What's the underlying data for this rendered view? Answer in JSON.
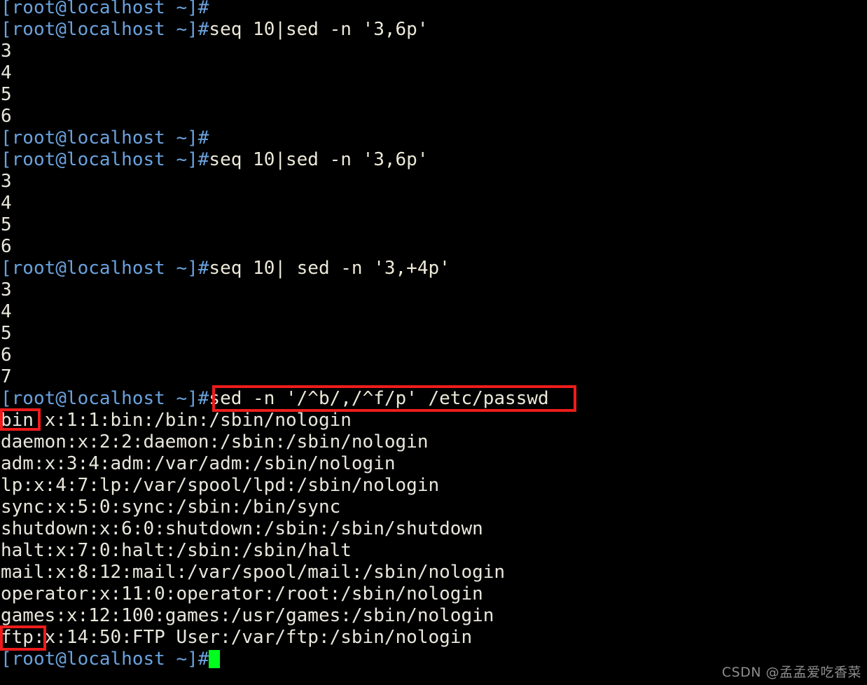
{
  "terminal": {
    "background_color": "#000000",
    "prompt_color": "#6aa2dd",
    "command_color": "#ece9d8",
    "output_color": "#e9e7dc",
    "cursor_color": "#00ff1e",
    "annotation_color": "#ee1c1c",
    "prompt": "[root@localhost ~]#",
    "lines": [
      {
        "type": "prompt",
        "prompt": "[root@localhost ~]#",
        "command": ""
      },
      {
        "type": "prompt",
        "prompt": "[root@localhost ~]#",
        "command": "seq 10|sed -n '3,6p'"
      },
      {
        "type": "output",
        "text": "3"
      },
      {
        "type": "output",
        "text": "4"
      },
      {
        "type": "output",
        "text": "5"
      },
      {
        "type": "output",
        "text": "6"
      },
      {
        "type": "prompt",
        "prompt": "[root@localhost ~]#",
        "command": ""
      },
      {
        "type": "prompt",
        "prompt": "[root@localhost ~]#",
        "command": "seq 10|sed -n '3,6p'"
      },
      {
        "type": "output",
        "text": "3"
      },
      {
        "type": "output",
        "text": "4"
      },
      {
        "type": "output",
        "text": "5"
      },
      {
        "type": "output",
        "text": "6"
      },
      {
        "type": "prompt",
        "prompt": "[root@localhost ~]#",
        "command": "seq 10| sed -n '3,+4p'"
      },
      {
        "type": "output",
        "text": "3"
      },
      {
        "type": "output",
        "text": "4"
      },
      {
        "type": "output",
        "text": "5"
      },
      {
        "type": "output",
        "text": "6"
      },
      {
        "type": "output",
        "text": "7"
      },
      {
        "type": "prompt",
        "prompt": "[root@localhost ~]#",
        "command": "sed -n '/^b/,/^f/p' /etc/passwd"
      },
      {
        "type": "output",
        "text": "bin:x:1:1:bin:/bin:/sbin/nologin"
      },
      {
        "type": "output",
        "text": "daemon:x:2:2:daemon:/sbin:/sbin/nologin"
      },
      {
        "type": "output",
        "text": "adm:x:3:4:adm:/var/adm:/sbin/nologin"
      },
      {
        "type": "output",
        "text": "lp:x:4:7:lp:/var/spool/lpd:/sbin/nologin"
      },
      {
        "type": "output",
        "text": "sync:x:5:0:sync:/sbin:/bin/sync"
      },
      {
        "type": "output",
        "text": "shutdown:x:6:0:shutdown:/sbin:/sbin/shutdown"
      },
      {
        "type": "output",
        "text": "halt:x:7:0:halt:/sbin:/sbin/halt"
      },
      {
        "type": "output",
        "text": "mail:x:8:12:mail:/var/spool/mail:/sbin/nologin"
      },
      {
        "type": "output",
        "text": "operator:x:11:0:operator:/root:/sbin/nologin"
      },
      {
        "type": "output",
        "text": "games:x:12:100:games:/usr/games:/sbin/nologin"
      },
      {
        "type": "output",
        "text": "ftp:x:14:50:FTP User:/var/ftp:/sbin/nologin"
      },
      {
        "type": "cursor",
        "prompt": "[root@localhost ~]#",
        "command": ""
      }
    ]
  },
  "annotations": {
    "command_box_label": "sed -n '/^b/,/^f/p' /etc/passwd",
    "bin_box_label": "bin:",
    "ftp_box_label": "ftp:"
  },
  "watermark": {
    "text": "CSDN @孟孟爱吃香菜"
  }
}
